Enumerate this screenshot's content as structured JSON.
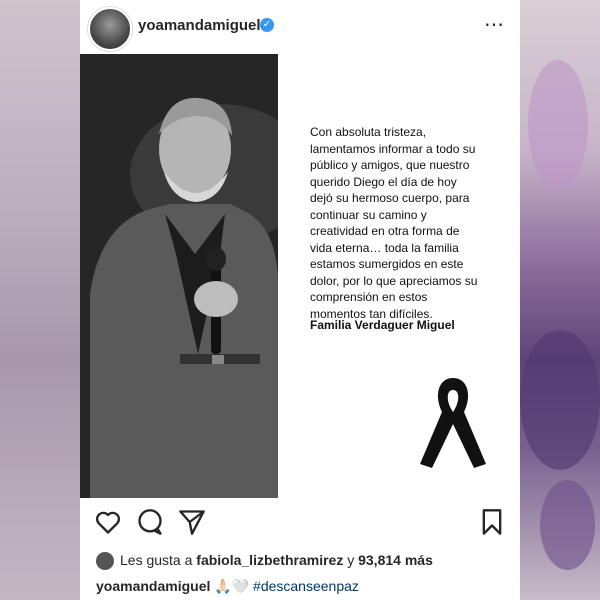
{
  "post": {
    "username": "yoamandamiguel",
    "more_icon": "⋯",
    "message": "Con absoluta tristeza, lamentamos informar a todo su público y amigos, que nuestro querido Diego el día de hoy dejó su hermoso cuerpo, para continuar su camino y creatividad en otra forma de vida eterna… toda la familia estamos sumergidos en este dolor, por lo que apreciamos su comprensión en estos momentos tan difíciles.",
    "signature": "Familia Verdaguer Miguel"
  },
  "likes": {
    "prefix": "Les gusta a",
    "user": "fabiola_lizbethramirez",
    "connector": "y",
    "count": "93,814",
    "suffix": "más"
  },
  "caption": {
    "username": "yoamandamiguel",
    "emojis": "🙏🏻🤍",
    "hashtag": "#descanseenpaz"
  },
  "colors": {
    "verified": "#3897f0",
    "hashtag": "#00376b",
    "text": "#262626"
  },
  "icons": [
    "verified-badge-icon",
    "more-options-icon",
    "heart-icon",
    "comment-icon",
    "share-icon",
    "bookmark-icon",
    "mourning-ribbon-icon"
  ]
}
